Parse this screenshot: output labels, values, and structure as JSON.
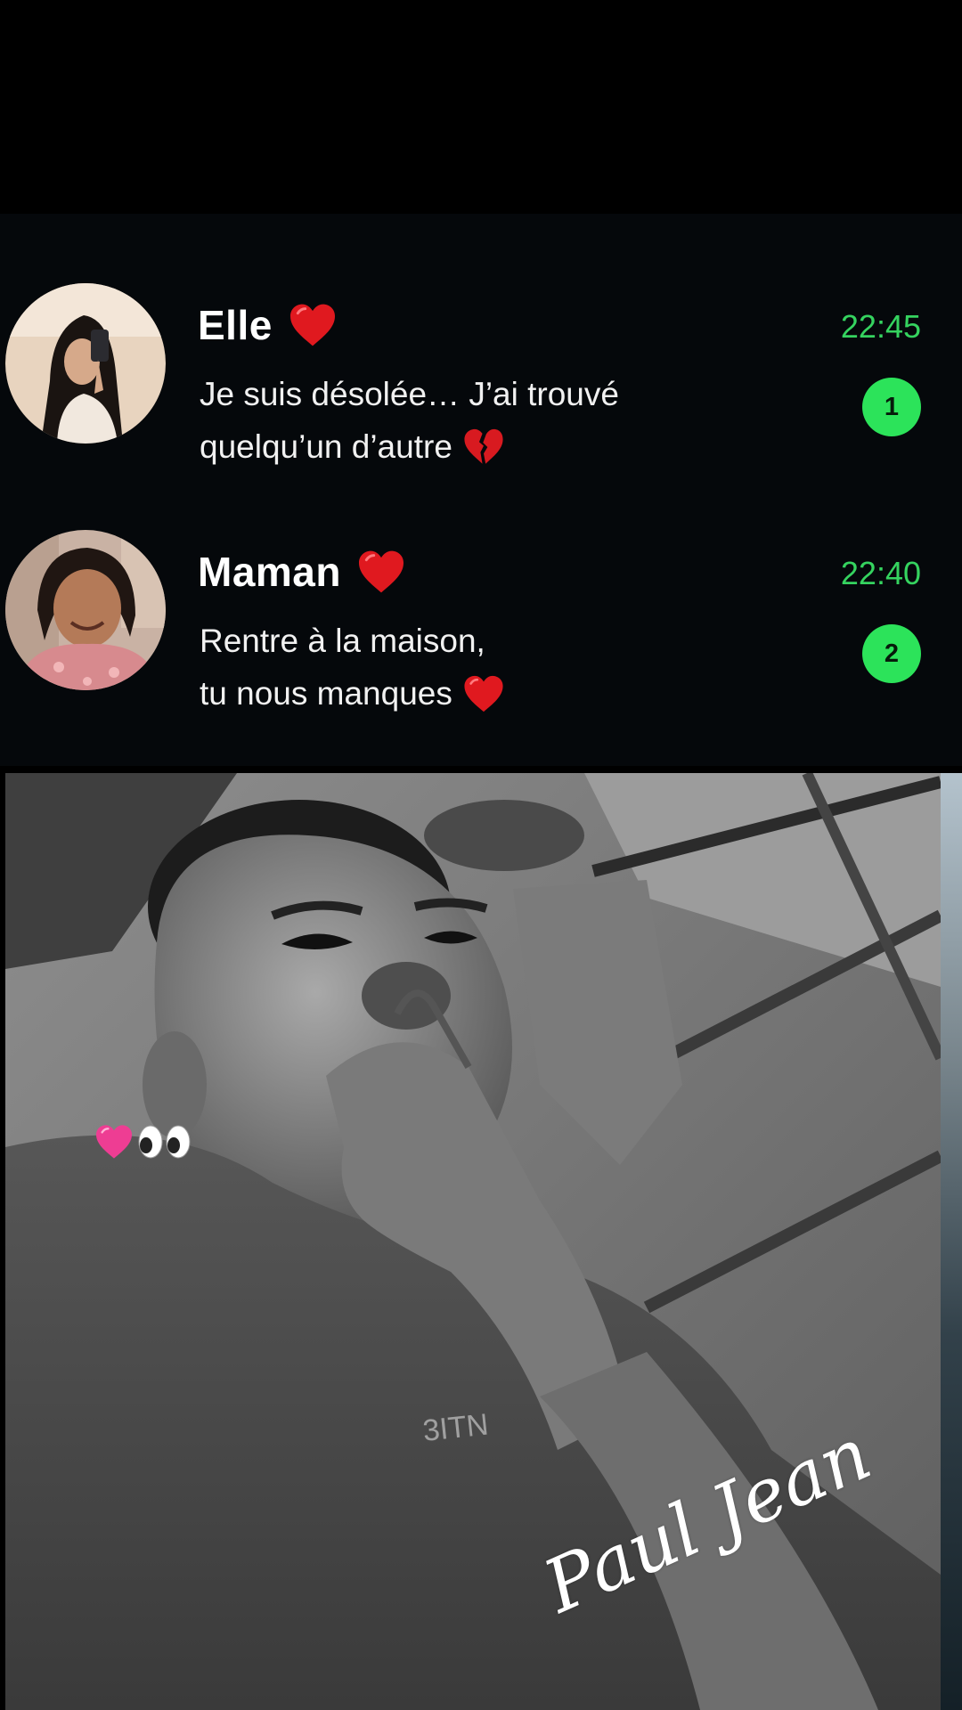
{
  "chats": [
    {
      "name": "Elle",
      "name_emoji": "red-heart-icon",
      "message_line_1": "Je suis désolée… J’ai trouvé",
      "message_line_2": "quelqu’un d’autre",
      "message_emoji": "broken-heart-icon",
      "time": "22:45",
      "unread_count": "1"
    },
    {
      "name": "Maman",
      "name_emoji": "red-heart-icon",
      "message_line_1": "Rentre à la maison,",
      "message_line_2": "tu nous manques",
      "message_emoji": "red-heart-icon",
      "time": "22:40",
      "unread_count": "2"
    }
  ],
  "photo": {
    "sticker_icons": [
      "pink-heart-icon",
      "eyes-icon"
    ],
    "signature": "Paul Jean"
  },
  "colors": {
    "background": "#000000",
    "chat_background": "#05080b",
    "time_green": "#35d35f",
    "badge_green": "#2ce35a",
    "heart_red": "#e0191f"
  }
}
